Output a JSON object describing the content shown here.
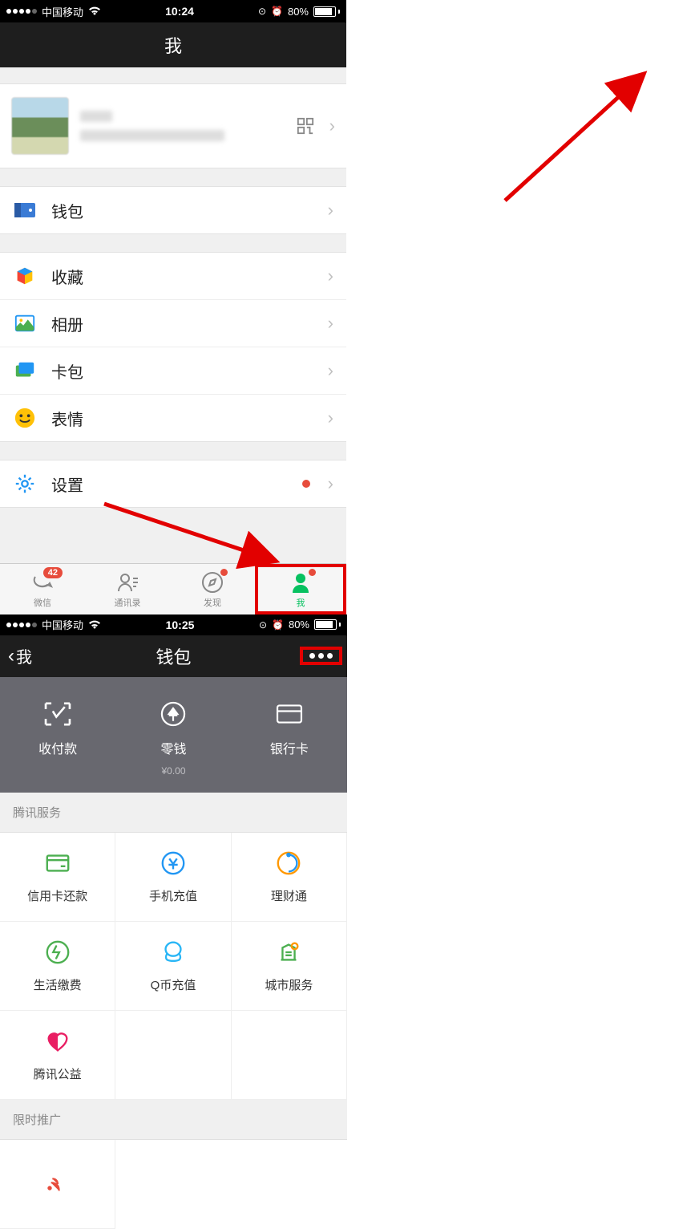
{
  "left": {
    "status": {
      "carrier": "中国移动",
      "time": "10:24",
      "battery": "80%"
    },
    "nav": {
      "title": "我"
    },
    "menu": [
      {
        "id": "wallet",
        "label": "钱包"
      },
      {
        "id": "favorites",
        "label": "收藏"
      },
      {
        "id": "album",
        "label": "相册"
      },
      {
        "id": "cards",
        "label": "卡包"
      },
      {
        "id": "stickers",
        "label": "表情"
      },
      {
        "id": "settings",
        "label": "设置"
      }
    ],
    "tabs": [
      {
        "id": "chats",
        "label": "微信",
        "badge": "42"
      },
      {
        "id": "contacts",
        "label": "通讯录"
      },
      {
        "id": "discover",
        "label": "发现"
      },
      {
        "id": "me",
        "label": "我"
      }
    ]
  },
  "right": {
    "status": {
      "carrier": "中国移动",
      "time": "10:25",
      "battery": "80%"
    },
    "nav": {
      "back": "我",
      "title": "钱包"
    },
    "walletCards": [
      {
        "id": "pay",
        "label": "收付款"
      },
      {
        "id": "money",
        "label": "零钱",
        "sub": "¥0.00"
      },
      {
        "id": "bank",
        "label": "银行卡"
      }
    ],
    "sections": [
      {
        "header": "腾讯服务",
        "items": [
          {
            "id": "credit",
            "label": "信用卡还款"
          },
          {
            "id": "topup",
            "label": "手机充值"
          },
          {
            "id": "finance",
            "label": "理财通"
          },
          {
            "id": "bills",
            "label": "生活缴费"
          },
          {
            "id": "qcoin",
            "label": "Q币充值"
          },
          {
            "id": "city",
            "label": "城市服务"
          },
          {
            "id": "charity",
            "label": "腾讯公益"
          }
        ]
      },
      {
        "header": "限时推广",
        "items": []
      }
    ]
  }
}
